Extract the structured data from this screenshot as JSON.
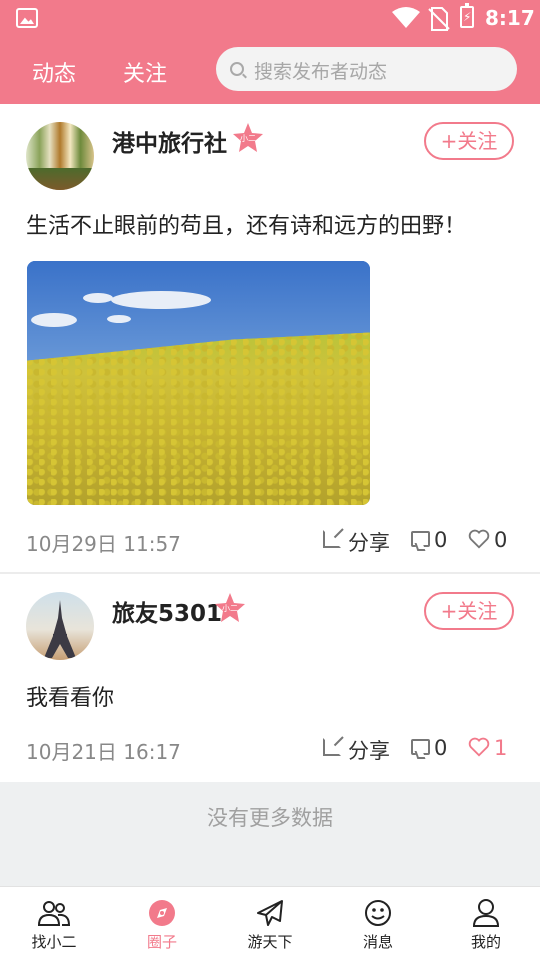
{
  "status_bar": {
    "time": "8:17"
  },
  "header": {
    "tabs": [
      {
        "label": "动态"
      },
      {
        "label": "关注"
      }
    ],
    "search": {
      "placeholder": "搜索发布者动态"
    }
  },
  "posts": [
    {
      "username": "港中旅行社",
      "badge": "小二",
      "follow_label": "+关注",
      "text": "生活不止眼前的苟且，还有诗和远方的田野！",
      "has_image": true,
      "date": "10月29日 11:57",
      "share_label": "分享",
      "comments": "0",
      "likes": "0",
      "liked": false
    },
    {
      "username": "旅友5301",
      "badge": "小二",
      "follow_label": "+关注",
      "text": "我看看你",
      "has_image": false,
      "date": "10月21日 16:17",
      "share_label": "分享",
      "comments": "0",
      "likes": "1",
      "liked": true
    }
  ],
  "no_more_text": "没有更多数据",
  "bottom_nav": {
    "items": [
      {
        "label": "找小二",
        "icon": "people-icon"
      },
      {
        "label": "圈子",
        "icon": "compass-icon",
        "active": true
      },
      {
        "label": "游天下",
        "icon": "airplane-icon"
      },
      {
        "label": "消息",
        "icon": "smiley-icon"
      },
      {
        "label": "我的",
        "icon": "person-icon"
      }
    ]
  },
  "colors": {
    "accent": "#f27a8b",
    "background_gray": "#eef0f1"
  }
}
